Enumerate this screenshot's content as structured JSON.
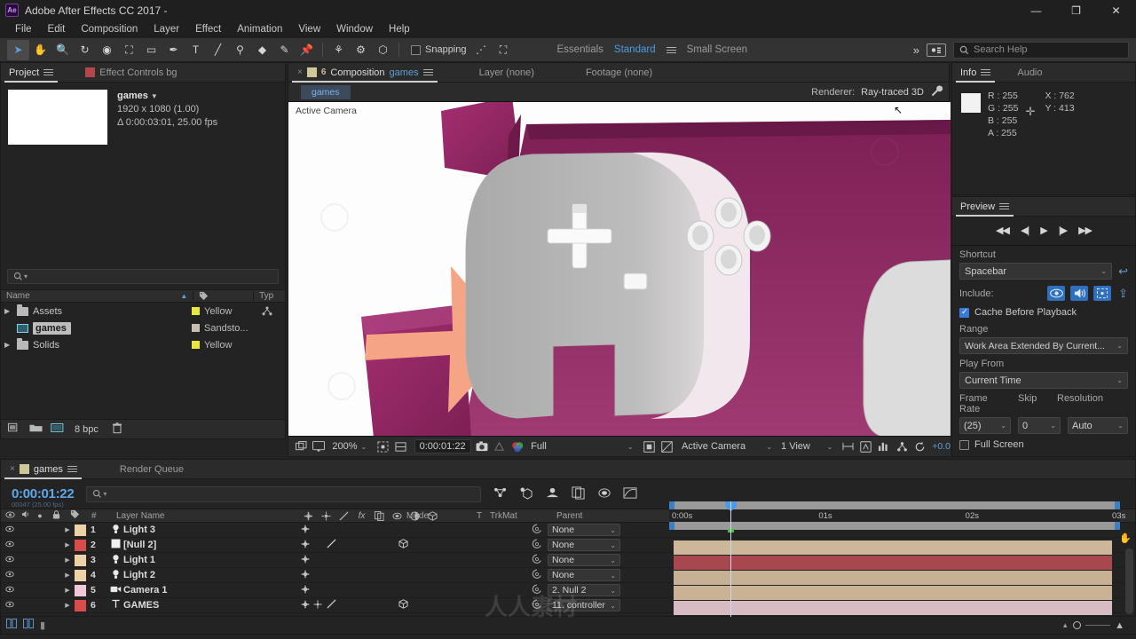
{
  "window": {
    "app_icon": "Ae",
    "title": "Adobe After Effects CC 2017 -",
    "minimize": "—",
    "maximize": "❐",
    "close": "✕"
  },
  "menubar": {
    "items": [
      "File",
      "Edit",
      "Composition",
      "Layer",
      "Effect",
      "Animation",
      "View",
      "Window",
      "Help"
    ]
  },
  "toolbar": {
    "tools": [
      {
        "name": "selection-tool",
        "glyph": "➤",
        "selected": true
      },
      {
        "name": "hand-tool",
        "glyph": "✋",
        "selected": false
      },
      {
        "name": "zoom-tool",
        "glyph": "🔍",
        "selected": false
      },
      {
        "name": "rotation-tool",
        "glyph": "↻",
        "selected": false
      },
      {
        "name": "orbit-camera-tool",
        "glyph": "◉",
        "selected": false
      },
      {
        "name": "pan-behind-tool",
        "glyph": "⛶",
        "selected": false
      },
      {
        "name": "shape-tool",
        "glyph": "▭",
        "selected": false
      },
      {
        "name": "pen-tool",
        "glyph": "✒",
        "selected": false
      },
      {
        "name": "type-tool",
        "glyph": "T",
        "selected": false
      },
      {
        "name": "brush-tool",
        "glyph": "╱",
        "selected": false
      },
      {
        "name": "clone-stamp-tool",
        "glyph": "⚲",
        "selected": false
      },
      {
        "name": "eraser-tool",
        "glyph": "◆",
        "selected": false
      },
      {
        "name": "roto-brush-tool",
        "glyph": "✎",
        "selected": false
      },
      {
        "name": "puppet-pin-tool",
        "glyph": "📌",
        "selected": false
      }
    ],
    "anchor_tools": [
      {
        "name": "unified-camera-tool",
        "glyph": "⚘"
      },
      {
        "name": "track-xy-camera-tool",
        "glyph": "⚙"
      },
      {
        "name": "track-z-camera-tool",
        "glyph": "⬡"
      }
    ],
    "snapping_label": "Snapping",
    "snapping_checked": false,
    "extra_tools": [
      {
        "name": "auto-align-tool",
        "glyph": "⋰"
      },
      {
        "name": "bounding-box-tool",
        "glyph": "⛶"
      }
    ],
    "workspaces": [
      {
        "label": "Essentials",
        "active": false
      },
      {
        "label": "Standard",
        "active": true
      },
      {
        "label": "Small Screen",
        "active": false
      }
    ],
    "overflow": "»",
    "sync_settings_icon": "sync-settings-icon",
    "search_help_placeholder": "Search Help"
  },
  "project_panel": {
    "tabs": [
      {
        "label": "Project",
        "active": true,
        "has_menu": true
      },
      {
        "label": "Effect Controls bg",
        "active": false,
        "swatch": "#b4464e"
      }
    ],
    "selected_item": {
      "name": "games",
      "dimensions": "1920 x 1080 (1.00)",
      "duration": "Δ 0:00:03:01, 25.00 fps"
    },
    "search_placeholder": "",
    "columns": [
      "Name",
      "tag",
      "Typ"
    ],
    "rows": [
      {
        "name": "Assets",
        "kind": "folder",
        "label": "Yellow",
        "label_color": "#e8e83c",
        "expandable": true,
        "selected": false
      },
      {
        "name": "games",
        "kind": "composition",
        "label": "Sandsto...",
        "label_color": "#c9bfae",
        "expandable": false,
        "selected": true
      },
      {
        "name": "Solids",
        "kind": "folder",
        "label": "Yellow",
        "label_color": "#e8e83c",
        "expandable": true,
        "selected": false
      }
    ],
    "footer": {
      "bit_depth": "8 bpc",
      "icons": [
        "interpret-footage-icon",
        "new-folder-icon",
        "new-composition-icon",
        "delete-icon"
      ]
    }
  },
  "comp_panel": {
    "tabs": [
      {
        "label": "Composition games",
        "prefix": "Composition",
        "name": "games",
        "active": true,
        "lock_glyph": "6",
        "swatch": "#cfc69a"
      },
      {
        "label": "Layer (none)",
        "active": false
      },
      {
        "label": "Footage (none)",
        "active": false
      }
    ],
    "breadcrumb": "games",
    "renderer_label": "Renderer:",
    "renderer_value": "Ray-traced 3D",
    "viewer_overlay": "Active Camera",
    "bottom_bar": {
      "magnification": "200%",
      "time": "0:00:01:22",
      "resolution": "Full",
      "camera_view": "Active Camera",
      "views": "1 View",
      "exposure": "+0.0",
      "icons": [
        "always-preview-icon",
        "toggle-transparency-grid-icon",
        "region-of-interest-icon",
        "grid-guides-icon",
        "take-snapshot-icon",
        "show-snapshot-icon",
        "channel-icon",
        "mask-icon",
        "toggle-view-layout-icon",
        "3d-ref-axes-icon",
        "timecode-icon",
        "renderer-options-icon",
        "reset-exposure-icon"
      ]
    }
  },
  "info_panel": {
    "tabs": [
      {
        "label": "Info",
        "active": true
      },
      {
        "label": "Audio",
        "active": false
      }
    ],
    "rgba": [
      {
        "key": "R",
        "value": "255"
      },
      {
        "key": "G",
        "value": "255"
      },
      {
        "key": "B",
        "value": "255"
      },
      {
        "key": "A",
        "value": "255"
      }
    ],
    "coords": [
      {
        "key": "X",
        "value": "762"
      },
      {
        "key": "Y",
        "value": "413"
      }
    ],
    "swatch_color": "#f2f2f2"
  },
  "preview_panel": {
    "title": "Preview",
    "transport": [
      {
        "name": "first-frame-button",
        "glyph": "◀◀"
      },
      {
        "name": "previous-frame-button",
        "glyph": "◀|"
      },
      {
        "name": "play-button",
        "glyph": "▶"
      },
      {
        "name": "next-frame-button",
        "glyph": "|▶"
      },
      {
        "name": "last-frame-button",
        "glyph": "▶▶"
      }
    ],
    "shortcut_label": "Shortcut",
    "shortcut_value": "Spacebar",
    "include_label": "Include:",
    "include_toggles": [
      {
        "name": "video-toggle",
        "glyph": "👁",
        "on": true
      },
      {
        "name": "audio-toggle",
        "glyph": "🔊",
        "on": true
      },
      {
        "name": "layer-controls-toggle",
        "glyph": "⛶",
        "on": true
      }
    ],
    "cache_label": "Cache Before Playback",
    "cache_checked": true,
    "range_label": "Range",
    "range_value": "Work Area Extended By Current...",
    "play_from_label": "Play From",
    "play_from_value": "Current Time",
    "frame_rate_label": "Frame Rate",
    "frame_rate_value": "(25)",
    "skip_label": "Skip",
    "skip_value": "0",
    "resolution_label": "Resolution",
    "resolution_value": "Auto",
    "full_screen_label": "Full Screen",
    "full_screen_checked": false
  },
  "timeline_panel": {
    "tabs": [
      {
        "label": "games",
        "active": true,
        "swatch": "#cfc69a"
      },
      {
        "label": "Render Queue",
        "active": false
      }
    ],
    "current_time": "0:00:01:22",
    "current_time_sub": "00047 (25.00 fps)",
    "search_placeholder": "",
    "switch_icons": [
      "composition-mini-flowchart-icon",
      "draft-3d-icon",
      "hide-shy-layers-icon",
      "frame-blending-icon",
      "motion-blur-icon",
      "graph-editor-icon"
    ],
    "columns": {
      "toggles": [
        "eye-icon",
        "audio-icon",
        "solo-icon",
        "lock-icon"
      ],
      "label": "tag-icon",
      "index": "#",
      "layer_name": "Layer Name",
      "switches": [
        "shy-icon",
        "collapse-icon",
        "quality-icon",
        "fx-icon",
        "frame-blend-icon",
        "motion-blur-icon",
        "adjustment-icon",
        "3d-icon"
      ],
      "mode": "Mode",
      "track_matte_t": "T",
      "track_matte": "TrkMat",
      "parent": "Parent"
    },
    "layers": [
      {
        "index": "1",
        "name": "Light 3",
        "type_icon": "light-icon",
        "color": "#edd2a8",
        "bar_color": "#cdb79a",
        "parent": "None",
        "has_3d": false,
        "has_audio": false
      },
      {
        "index": "2",
        "name": "[Null 2]",
        "type_icon": "solid-icon",
        "color": "#d94c4c",
        "bar_color": "#a8474d",
        "parent": "None",
        "has_3d": true,
        "has_audio": false
      },
      {
        "index": "3",
        "name": "Light 1",
        "type_icon": "light-icon",
        "color": "#edd2a8",
        "bar_color": "#c8b094",
        "parent": "None",
        "has_3d": false,
        "has_audio": false
      },
      {
        "index": "4",
        "name": "Light 2",
        "type_icon": "light-icon",
        "color": "#edd2a8",
        "bar_color": "#cbb295",
        "parent": "None",
        "has_3d": false,
        "has_audio": false
      },
      {
        "index": "5",
        "name": "Camera 1",
        "type_icon": "camera-icon",
        "color": "#f0c7d6",
        "bar_color": "#d8bcc4",
        "parent": "2. Null 2",
        "has_3d": false,
        "has_audio": false
      },
      {
        "index": "6",
        "name": "GAMES",
        "type_icon": "text-icon",
        "color": "#d94c4c",
        "bar_color": "#a8474d",
        "parent": "11. controller",
        "has_3d": true,
        "has_audio": false
      }
    ],
    "ruler": {
      "ticks": [
        "0:00s",
        "01s",
        "02s",
        "03s"
      ],
      "playhead_position": "02s",
      "work_area_start": "0:00s",
      "work_area_end": "03s"
    }
  },
  "colors": {
    "accent_blue": "#4f9ae4",
    "panel_bg": "#232323",
    "panel_header": "#2b2b2b",
    "toolbar_bg": "#333333",
    "scene_magenta": "#8e2c63",
    "scene_arrow": "#f6a486"
  }
}
